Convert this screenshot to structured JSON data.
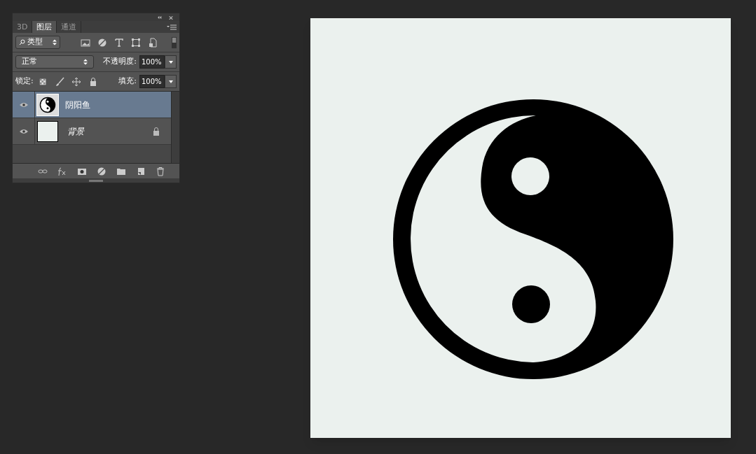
{
  "panel": {
    "tabs": [
      {
        "label": "3D",
        "selected": false
      },
      {
        "label": "图层",
        "selected": true
      },
      {
        "label": "通道",
        "selected": false
      }
    ],
    "filter": {
      "value": "类型",
      "on": true
    },
    "blend_mode": {
      "value": "正常"
    },
    "opacity": {
      "label": "不透明度:",
      "value": "100%"
    },
    "lock": {
      "label": "锁定:"
    },
    "fill": {
      "label": "填充:",
      "value": "100%"
    },
    "layers": [
      {
        "name": "阴阳鱼",
        "kind": "image",
        "selected": true,
        "visible": true,
        "locked": false
      },
      {
        "name": "背景",
        "kind": "solid",
        "selected": false,
        "visible": true,
        "locked": true
      }
    ]
  }
}
